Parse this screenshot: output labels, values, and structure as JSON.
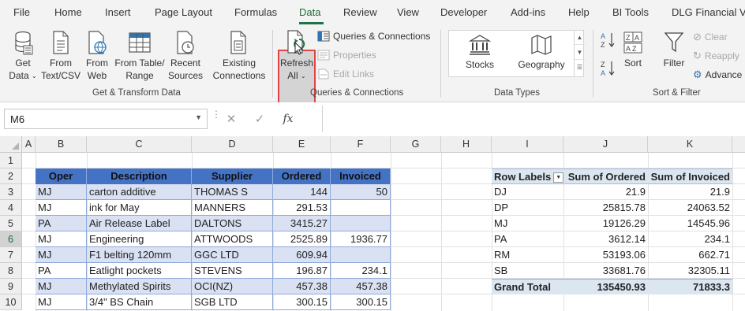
{
  "ribbon_tabs": [
    "File",
    "Home",
    "Insert",
    "Page Layout",
    "Formulas",
    "Data",
    "Review",
    "View",
    "Developer",
    "Add-ins",
    "Help",
    "BI Tools",
    "DLG Financial Vi"
  ],
  "active_tab": "Data",
  "get_transform": {
    "get_data_line1": "Get",
    "get_data_line2": "Data",
    "from_text_line1": "From",
    "from_text_line2": "Text/CSV",
    "from_web_line1": "From",
    "from_web_line2": "Web",
    "from_table_line1": "From Table/",
    "from_table_line2": "Range",
    "recent_line1": "Recent",
    "recent_line2": "Sources",
    "existing_line1": "Existing",
    "existing_line2": "Connections",
    "group_label": "Get & Transform Data"
  },
  "queries": {
    "refresh_line1": "Refresh",
    "refresh_line2": "All",
    "queries_connections": "Queries & Connections",
    "properties": "Properties",
    "edit_links": "Edit Links",
    "group_label": "Queries & Connections"
  },
  "data_types": {
    "stocks": "Stocks",
    "geography": "Geography",
    "group_label": "Data Types"
  },
  "sort_filter": {
    "sort": "Sort",
    "filter": "Filter",
    "clear": "Clear",
    "reapply": "Reapply",
    "advanced": "Advance",
    "group_label": "Sort & Filter"
  },
  "formula_bar": {
    "name_box": "M6",
    "cancel_glyph": "✕",
    "enter_glyph": "✓",
    "fx": "fx",
    "formula": ""
  },
  "columns": [
    "A",
    "B",
    "C",
    "D",
    "E",
    "F",
    "G",
    "H",
    "I",
    "J",
    "K"
  ],
  "rows": [
    "1",
    "2",
    "3",
    "4",
    "5",
    "6",
    "7",
    "8",
    "9",
    "10"
  ],
  "selected_row": "6",
  "table": {
    "headers": [
      "Oper",
      "Description",
      "Supplier",
      "Ordered",
      "Invoiced"
    ],
    "rows": [
      [
        "MJ",
        "carton additive",
        "THOMAS S",
        "144",
        "50"
      ],
      [
        "MJ",
        "ink for May",
        "MANNERS",
        "291.53",
        ""
      ],
      [
        "PA",
        "Air Release Label",
        "DALTONS",
        "3415.27",
        ""
      ],
      [
        "MJ",
        "Engineering",
        "ATTWOODS",
        "2525.89",
        "1936.77"
      ],
      [
        "MJ",
        "F1 belting 120mm",
        "GGC LTD",
        "609.94",
        ""
      ],
      [
        "PA",
        "Eatlight pockets",
        "STEVENS",
        "196.87",
        "234.1"
      ],
      [
        "MJ",
        "Methylated Spirits",
        "OCI(NZ)",
        "457.38",
        "457.38"
      ],
      [
        "MJ",
        "3/4\" BS Chain",
        "SGB LTD",
        "300.15",
        "300.15"
      ]
    ]
  },
  "pivot": {
    "headers": [
      "Row Labels",
      "Sum of Ordered",
      "Sum of Invoiced"
    ],
    "rows": [
      [
        "DJ",
        "21.9",
        "21.9"
      ],
      [
        "DP",
        "25815.78",
        "24063.52"
      ],
      [
        "MJ",
        "19126.29",
        "14545.96"
      ],
      [
        "PA",
        "3612.14",
        "234.1"
      ],
      [
        "RM",
        "53193.06",
        "662.71"
      ],
      [
        "SB",
        "33681.76",
        "32305.11"
      ]
    ],
    "total": [
      "Grand Total",
      "135450.93",
      "71833.3"
    ]
  }
}
